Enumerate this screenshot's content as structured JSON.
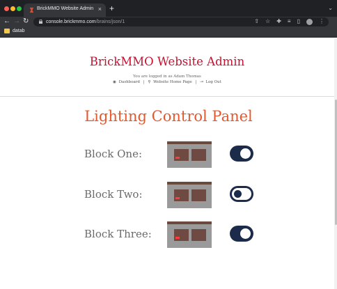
{
  "browser": {
    "tab_title": "BrickMMO Website Admin",
    "tab_close_icon": "close-icon",
    "new_tab_label": "+",
    "url_host": "console.brickmmo.com",
    "url_path": "/brains/json/1",
    "bookmark_label": "datab"
  },
  "header": {
    "site_title": "BrickMMO Website Admin",
    "login_text": "You are logged in as Adam Thomas",
    "nav": {
      "dashboard": "Dashboard",
      "separator": "|",
      "home": "Website Home Page",
      "logout": "Log Out"
    }
  },
  "panel": {
    "title": "Lighting Control Panel",
    "blocks": [
      {
        "label": "Block One:",
        "light_on": true
      },
      {
        "label": "Block Two:",
        "light_on": false
      },
      {
        "label": "Block Three:",
        "light_on": true
      }
    ]
  },
  "colors": {
    "site_title": "#c8102e",
    "panel_title": "#e8572b",
    "toggle": "#1c2b4a",
    "building_light": "#ff3b3b"
  }
}
